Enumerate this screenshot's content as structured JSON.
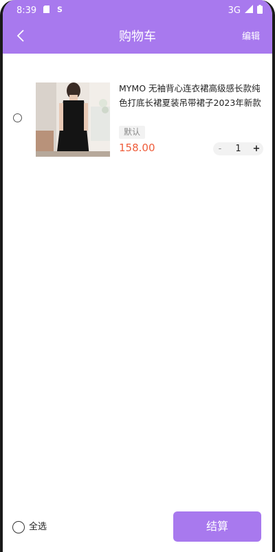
{
  "status_bar": {
    "time": "8:39",
    "network": "3G"
  },
  "nav": {
    "title": "购物车",
    "edit_label": "编辑"
  },
  "cart": {
    "items": [
      {
        "title": "MYMO 无袖背心连衣裙高级感长款纯色打底长裙夏装吊带裙子2023年新款",
        "spec": "默认",
        "price": "158.00",
        "quantity": "1",
        "minus": "-",
        "plus": "+",
        "thumb_icon": "black-dress-photo"
      }
    ]
  },
  "footer": {
    "select_all_label": "全选",
    "checkout_label": "结算"
  },
  "colors": {
    "accent": "#a879ee",
    "price": "#ef5d3b"
  }
}
